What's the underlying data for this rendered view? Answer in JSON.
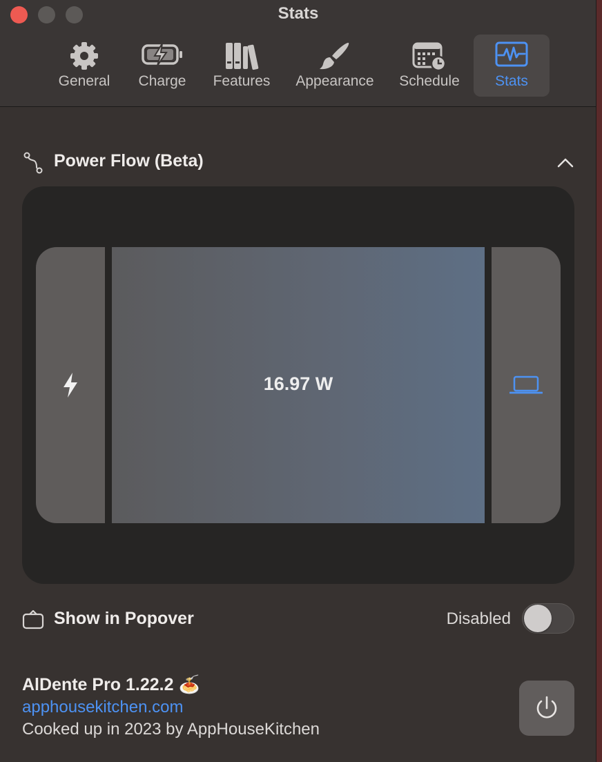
{
  "window": {
    "title": "Stats"
  },
  "tabs": [
    {
      "label": "General",
      "icon": "gear-icon",
      "active": false
    },
    {
      "label": "Charge",
      "icon": "battery-charge-icon",
      "active": false
    },
    {
      "label": "Features",
      "icon": "books-icon",
      "active": false
    },
    {
      "label": "Appearance",
      "icon": "paintbrush-icon",
      "active": false
    },
    {
      "label": "Schedule",
      "icon": "calendar-clock-icon",
      "active": false
    },
    {
      "label": "Stats",
      "icon": "waveform-icon",
      "active": true
    }
  ],
  "power_flow": {
    "title": "Power Flow (Beta)",
    "icon": "flow-path-icon",
    "expanded": true,
    "source_icon": "bolt-icon",
    "wattage": "16.97 W",
    "destination_icon": "laptop-icon"
  },
  "popover": {
    "title": "Show in Popover",
    "icon": "popover-icon",
    "status": "Disabled",
    "enabled": false
  },
  "footer": {
    "app_name": "AlDente Pro 1.22.2 🍝",
    "link": "apphousekitchen.com",
    "credit": "Cooked up in 2023 by AppHouseKitchen"
  },
  "colors": {
    "accent": "#4d92f3",
    "close": "#ee5a52",
    "window_bg": "#373230"
  }
}
